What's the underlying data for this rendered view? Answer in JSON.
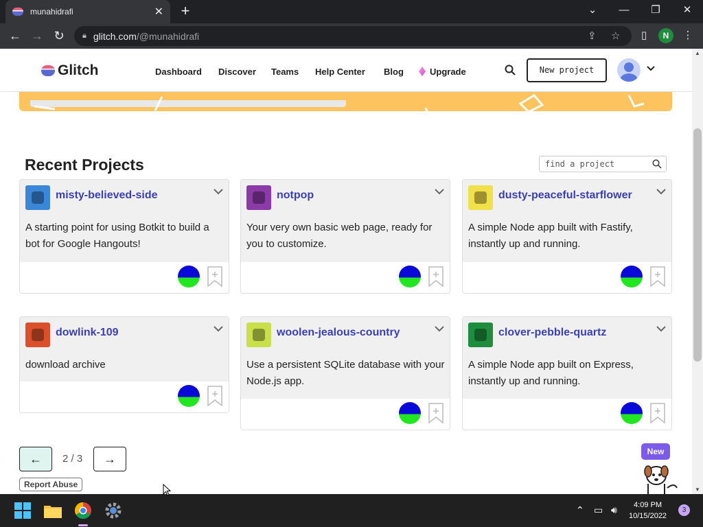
{
  "browser": {
    "tab_title": "munahidrafi",
    "url_host": "glitch.com",
    "url_path": "/@munahidrafi",
    "profile_initial": "N"
  },
  "header": {
    "logo": "Glitch",
    "nav": [
      "Dashboard",
      "Discover",
      "Teams",
      "Help Center",
      "Blog",
      "Upgrade"
    ],
    "new_project": "New project"
  },
  "recent": {
    "title": "Recent Projects",
    "search_placeholder": "find a project",
    "projects": [
      {
        "name": "misty-believed-side",
        "desc": "A starting point for using Botkit to build a bot for Google Hangouts!",
        "color": "#3a86d9"
      },
      {
        "name": "notpop",
        "desc": "Your very own basic web page, ready for you to customize.",
        "color": "#8c3aa8"
      },
      {
        "name": "dusty-peaceful-starflower",
        "desc": "A simple Node app built with Fastify, instantly up and running.",
        "color": "#f0e04a"
      },
      {
        "name": "dowlink-109",
        "desc": "download archive",
        "color": "#d9502a"
      },
      {
        "name": "woolen-jealous-country",
        "desc": "Use a persistent SQLite database with your Node.js app.",
        "color": "#c9e04a"
      },
      {
        "name": "clover-pebble-quartz",
        "desc": "A simple Node app built on Express, instantly up and running.",
        "color": "#1e8e3e"
      }
    ]
  },
  "pager": {
    "label": "2 / 3"
  },
  "report_abuse": "Report Abuse",
  "new_badge": "New",
  "taskbar": {
    "time": "4:09 PM",
    "date": "10/15/2022",
    "notifications": "3"
  }
}
